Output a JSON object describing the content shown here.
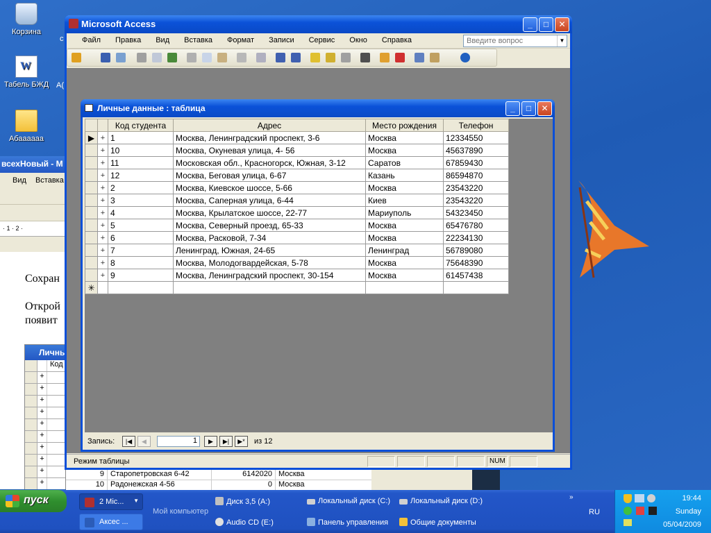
{
  "desktop": {
    "icons": [
      {
        "label": "Корзина"
      },
      {
        "label": "Табель БЖД"
      },
      {
        "label": "Абаааааа"
      }
    ],
    "side_fragments": {
      "a": "А(",
      "b": "с"
    }
  },
  "background_word": {
    "title": "всехНовый - М",
    "menu": [
      "Вид",
      "Вставка"
    ],
    "ruler": "· 1 · 2 ·",
    "text_lines": [
      "Сохран",
      "Открой",
      "появит"
    ],
    "table_title": "Личны",
    "table_header": "Код",
    "bottom_rows": [
      {
        "id": "9",
        "street": "Старопетровская 6-42",
        "phone": "6142020",
        "city": "Москва"
      },
      {
        "id": "10",
        "street": "Радонежская 4-56",
        "phone": "0",
        "city": "Москва"
      }
    ]
  },
  "access": {
    "title": "Microsoft Access",
    "menu": [
      "Файл",
      "Правка",
      "Вид",
      "Вставка",
      "Формат",
      "Записи",
      "Сервис",
      "Окно",
      "Справка"
    ],
    "question_placeholder": "Введите вопрос",
    "status": {
      "mode": "Режим таблицы",
      "num": "NUM"
    }
  },
  "table_window": {
    "title": "Личные данные : таблица",
    "columns": [
      "Код студента",
      "Адрес",
      "Место рождения",
      "Телефон"
    ],
    "rows": [
      [
        "1",
        "Москва, Ленинградский проспект, 3-6",
        "Москва",
        "12334550"
      ],
      [
        "10",
        "Москва, Окуневая улица, 4- 56",
        "Москва",
        "45637890"
      ],
      [
        "11",
        "Московская обл., Красногорск, Южная, 3-12",
        "Саратов",
        "67859430"
      ],
      [
        "12",
        "Москва, Беговая улица, 6-67",
        " Казань",
        "86594870"
      ],
      [
        "2",
        "Москва, Киевское шоссе, 5-66",
        "Москва",
        "23543220"
      ],
      [
        "3",
        "Москва, Саперная улица, 6-44",
        "Киев",
        "23543220"
      ],
      [
        "4",
        "Москва, Крылатское шоссе, 22-77",
        "Мариуполь",
        "54323450"
      ],
      [
        "5",
        "Москва, Северный проезд, 65-33",
        "Москва",
        "65476780"
      ],
      [
        "6",
        "Москва, Расковой, 7-34",
        "Москва",
        "22234130"
      ],
      [
        "7",
        "Ленинград, Южная, 24-65",
        "Ленинград",
        "56789080"
      ],
      [
        "8",
        "Москва, Молодогвардейская, 5-78",
        "Москва",
        "75648390"
      ],
      [
        "9",
        "Москва, Ленинградский проспект, 30-154",
        "Москва",
        "61457438"
      ]
    ],
    "navigator": {
      "label": "Запись:",
      "current": "1",
      "of_label": "из",
      "total": "12"
    }
  },
  "taskbar": {
    "start": "пуск",
    "buttons": [
      {
        "label": "2 Mic..."
      },
      {
        "label": "Аксес ..."
      }
    ],
    "my_computer": "Мой компьютер",
    "links": [
      "Диск 3,5 (A:)",
      "Локальный диск (C:)",
      "Локальный диск (D:)",
      "Audio CD (E:)",
      "Панель управления",
      "Общие документы"
    ],
    "lang": "RU",
    "time": "19:44",
    "day": "Sunday",
    "date": "05/04/2009"
  }
}
